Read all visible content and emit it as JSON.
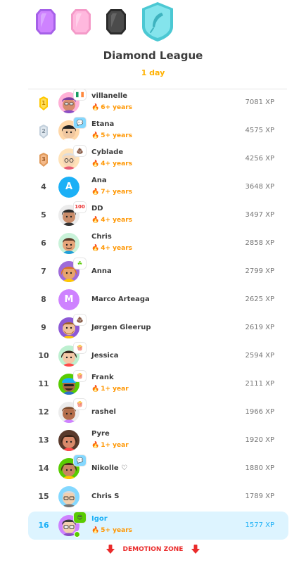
{
  "league": {
    "title": "Diamond League",
    "time_left": "1 day"
  },
  "tiers": [
    {
      "name": "amethyst-badge",
      "color": "#ce82ff"
    },
    {
      "name": "pearl-badge",
      "color": "#ffa8d6"
    },
    {
      "name": "obsidian-badge",
      "color": "#4b4b4b"
    },
    {
      "name": "diamond-badge",
      "color": "#7ee2ea"
    }
  ],
  "leaderboard": [
    {
      "rank": "1",
      "name": "villanelle",
      "streak": "6+ years",
      "xp": "7081 XP"
    },
    {
      "rank": "2",
      "name": "Etana",
      "streak": "5+ years",
      "xp": "4575 XP"
    },
    {
      "rank": "3",
      "name": "Cyblade",
      "streak": "4+ years",
      "xp": "4256 XP"
    },
    {
      "rank": "4",
      "name": "Ana",
      "streak": "7+ years",
      "xp": "3648 XP",
      "initial": "A"
    },
    {
      "rank": "5",
      "name": "DD",
      "streak": "4+ years",
      "xp": "3497 XP"
    },
    {
      "rank": "6",
      "name": "Chris",
      "streak": "4+ years",
      "xp": "2858 XP"
    },
    {
      "rank": "7",
      "name": "Anna",
      "streak": "",
      "xp": "2799 XP"
    },
    {
      "rank": "8",
      "name": "Marco Arteaga",
      "streak": "",
      "xp": "2625 XP",
      "initial": "M"
    },
    {
      "rank": "9",
      "name": "Jørgen Gleerup",
      "streak": "",
      "xp": "2619 XP"
    },
    {
      "rank": "10",
      "name": "Jessica",
      "streak": "",
      "xp": "2594 XP"
    },
    {
      "rank": "11",
      "name": "Frank",
      "streak": "1+ year",
      "xp": "2111 XP"
    },
    {
      "rank": "12",
      "name": "rashel",
      "streak": "",
      "xp": "1966 XP"
    },
    {
      "rank": "13",
      "name": "Pyre",
      "streak": "1+ year",
      "xp": "1920 XP"
    },
    {
      "rank": "14",
      "name": "Nikolle ♡",
      "streak": "",
      "xp": "1880 XP"
    },
    {
      "rank": "15",
      "name": "Chris S",
      "streak": "",
      "xp": "1789 XP"
    },
    {
      "rank": "16",
      "name": "Igor",
      "streak": "5+ years",
      "xp": "1577 XP"
    }
  ],
  "demotion_label": "DEMOTION ZONE",
  "colors": {
    "streak": "#ff9600",
    "highlight_bg": "#ddf4ff",
    "highlight_text": "#1cb0f6",
    "demotion": "#ea2b2b"
  }
}
